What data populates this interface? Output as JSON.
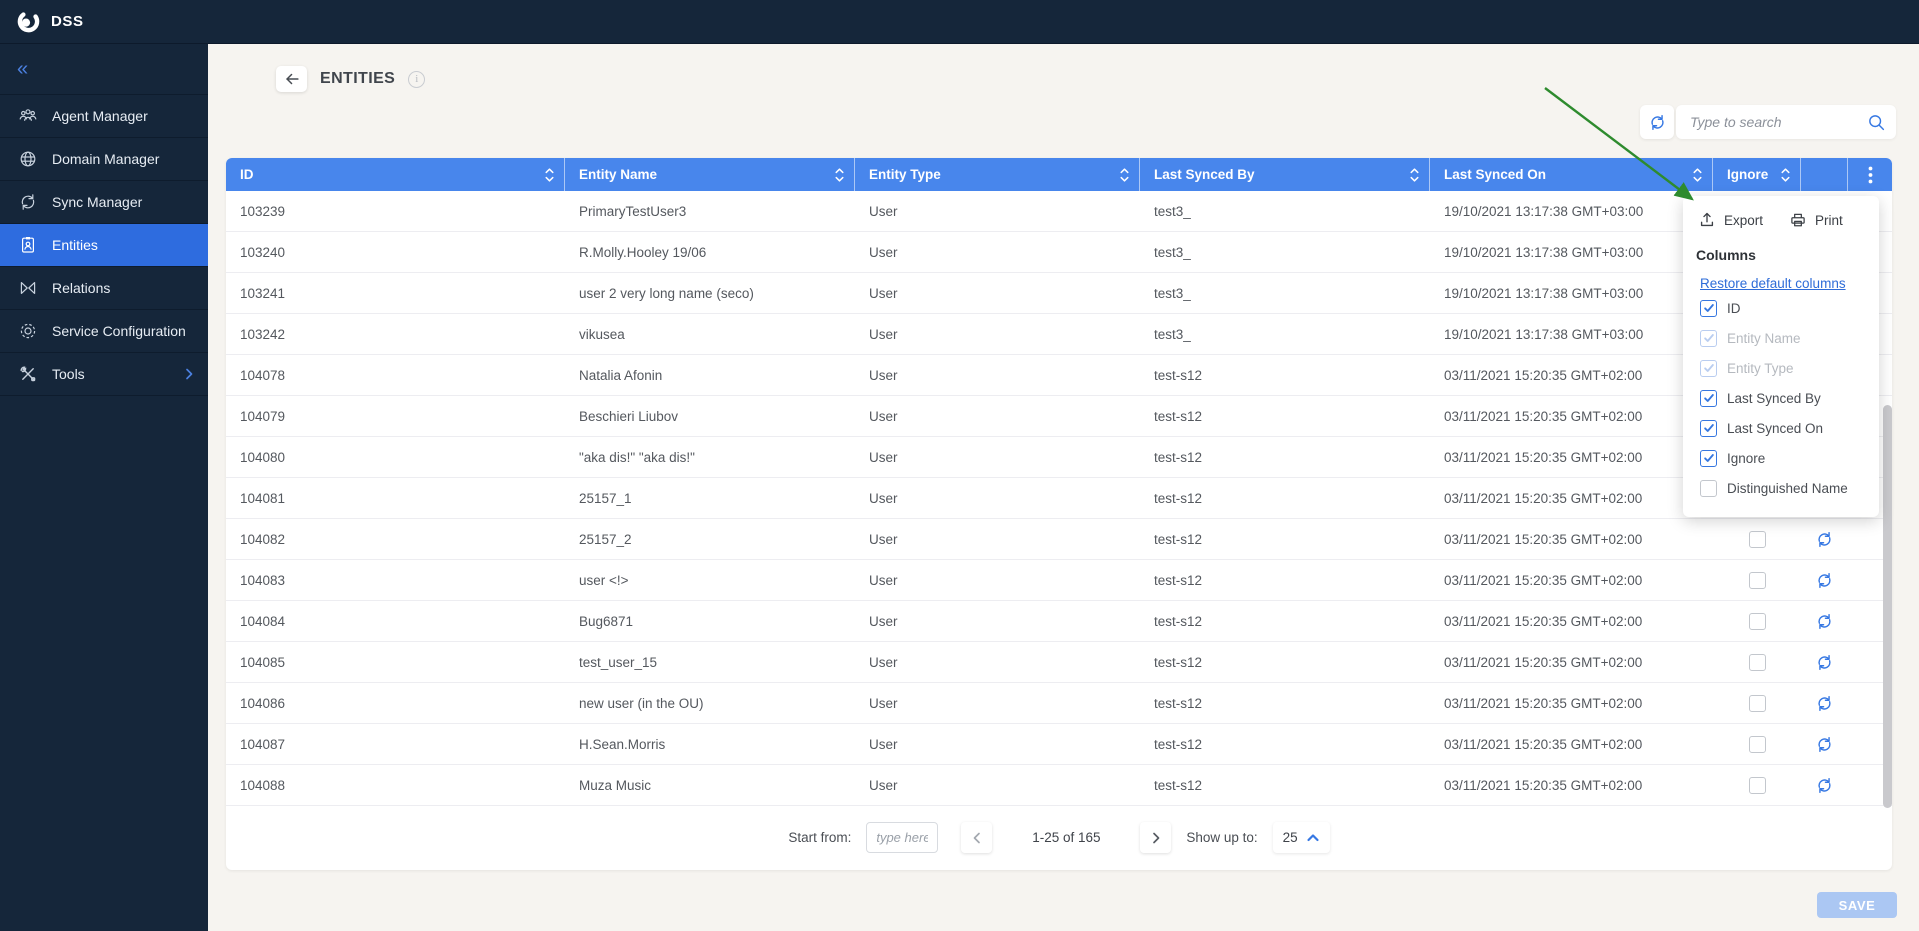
{
  "app": {
    "brand": "DSS"
  },
  "sidebar": {
    "collapse_icon": "«",
    "items": [
      {
        "label": "Agent Manager",
        "icon": "agents-icon",
        "selected": false,
        "chevron": false
      },
      {
        "label": "Domain Manager",
        "icon": "globe-icon",
        "selected": false,
        "chevron": false
      },
      {
        "label": "Sync Manager",
        "icon": "sync-icon",
        "selected": false,
        "chevron": false
      },
      {
        "label": "Entities",
        "icon": "badge-icon",
        "selected": true,
        "chevron": false
      },
      {
        "label": "Relations",
        "icon": "relations-icon",
        "selected": false,
        "chevron": false
      },
      {
        "label": "Service Configuration",
        "icon": "gear-icon",
        "selected": false,
        "chevron": false
      },
      {
        "label": "Tools",
        "icon": "tools-icon",
        "selected": false,
        "chevron": true
      }
    ]
  },
  "page": {
    "title": "ENTITIES",
    "info_glyph": "i"
  },
  "toolbar": {
    "search_placeholder": "Type to search"
  },
  "table": {
    "columns": [
      {
        "key": "id",
        "label": "ID",
        "sortable": true,
        "kebab": false
      },
      {
        "key": "name",
        "label": "Entity Name",
        "sortable": true,
        "kebab": false
      },
      {
        "key": "type",
        "label": "Entity Type",
        "sortable": true,
        "kebab": false
      },
      {
        "key": "syncedby",
        "label": "Last Synced By",
        "sortable": true,
        "kebab": false
      },
      {
        "key": "syncedon",
        "label": "Last Synced On",
        "sortable": true,
        "kebab": false
      },
      {
        "key": "ignore",
        "label": "Ignore",
        "sortable": true,
        "kebab": false
      },
      {
        "key": "refresh",
        "label": "",
        "sortable": false,
        "kebab": false
      },
      {
        "key": "kebab",
        "label": "",
        "sortable": false,
        "kebab": true
      }
    ],
    "rows": [
      {
        "id": "103239",
        "name": "PrimaryTestUser3",
        "type": "User",
        "synced_by": "test3_",
        "synced_on": "19/10/2021 13:17:38 GMT+03:00"
      },
      {
        "id": "103240",
        "name": "R.Molly.Hooley 19/06",
        "type": "User",
        "synced_by": "test3_",
        "synced_on": "19/10/2021 13:17:38 GMT+03:00"
      },
      {
        "id": "103241",
        "name": "user 2 very long name (seco)",
        "type": "User",
        "synced_by": "test3_",
        "synced_on": "19/10/2021 13:17:38 GMT+03:00"
      },
      {
        "id": "103242",
        "name": "vikusea",
        "type": "User",
        "synced_by": "test3_",
        "synced_on": "19/10/2021 13:17:38 GMT+03:00"
      },
      {
        "id": "104078",
        "name": "Natalia Afonin",
        "type": "User",
        "synced_by": "test-s12",
        "synced_on": "03/11/2021 15:20:35 GMT+02:00"
      },
      {
        "id": "104079",
        "name": "Beschieri Liubov",
        "type": "User",
        "synced_by": "test-s12",
        "synced_on": "03/11/2021 15:20:35 GMT+02:00"
      },
      {
        "id": "104080",
        "name": "\"aka dis!\" \"aka dis!\"",
        "type": "User",
        "synced_by": "test-s12",
        "synced_on": "03/11/2021 15:20:35 GMT+02:00"
      },
      {
        "id": "104081",
        "name": "25157_1",
        "type": "User",
        "synced_by": "test-s12",
        "synced_on": "03/11/2021 15:20:35 GMT+02:00"
      },
      {
        "id": "104082",
        "name": "25157_2",
        "type": "User",
        "synced_by": "test-s12",
        "synced_on": "03/11/2021 15:20:35 GMT+02:00"
      },
      {
        "id": "104083",
        "name": "user <!>",
        "type": "User",
        "synced_by": "test-s12",
        "synced_on": "03/11/2021 15:20:35 GMT+02:00"
      },
      {
        "id": "104084",
        "name": "Bug6871",
        "type": "User",
        "synced_by": "test-s12",
        "synced_on": "03/11/2021 15:20:35 GMT+02:00"
      },
      {
        "id": "104085",
        "name": "test_user_15",
        "type": "User",
        "synced_by": "test-s12",
        "synced_on": "03/11/2021 15:20:35 GMT+02:00"
      },
      {
        "id": "104086",
        "name": "new user (in the OU)",
        "type": "User",
        "synced_by": "test-s12",
        "synced_on": "03/11/2021 15:20:35 GMT+02:00"
      },
      {
        "id": "104087",
        "name": "H.Sean.Morris",
        "type": "User",
        "synced_by": "test-s12",
        "synced_on": "03/11/2021 15:20:35 GMT+02:00"
      },
      {
        "id": "104088",
        "name": "Muza Music",
        "type": "User",
        "synced_by": "test-s12",
        "synced_on": "03/11/2021 15:20:35 GMT+02:00"
      }
    ]
  },
  "column_menu": {
    "export_label": "Export",
    "print_label": "Print",
    "heading": "Columns",
    "restore_link": "Restore default columns",
    "toggles": [
      {
        "label": "ID",
        "checked": true,
        "disabled": false
      },
      {
        "label": "Entity Name",
        "checked": true,
        "disabled": true
      },
      {
        "label": "Entity Type",
        "checked": true,
        "disabled": true
      },
      {
        "label": "Last Synced By",
        "checked": true,
        "disabled": false
      },
      {
        "label": "Last Synced On",
        "checked": true,
        "disabled": false
      },
      {
        "label": "Ignore",
        "checked": true,
        "disabled": false
      },
      {
        "label": "Distinguished Name",
        "checked": false,
        "disabled": false
      }
    ]
  },
  "pagination": {
    "start_from_label": "Start from:",
    "start_placeholder": "type here..",
    "range_text": "1-25 of 165",
    "show_up_to_label": "Show up to:",
    "page_size": "25"
  },
  "footer": {
    "save_label": "SAVE"
  },
  "annotation": {
    "arrow_color": "#2e8b2e"
  },
  "colors": {
    "topbar": "#15263a",
    "selected_item": "#2e6cdf",
    "table_header": "#4886ec",
    "accent": "#3678e3",
    "link": "#2e6cd8"
  }
}
